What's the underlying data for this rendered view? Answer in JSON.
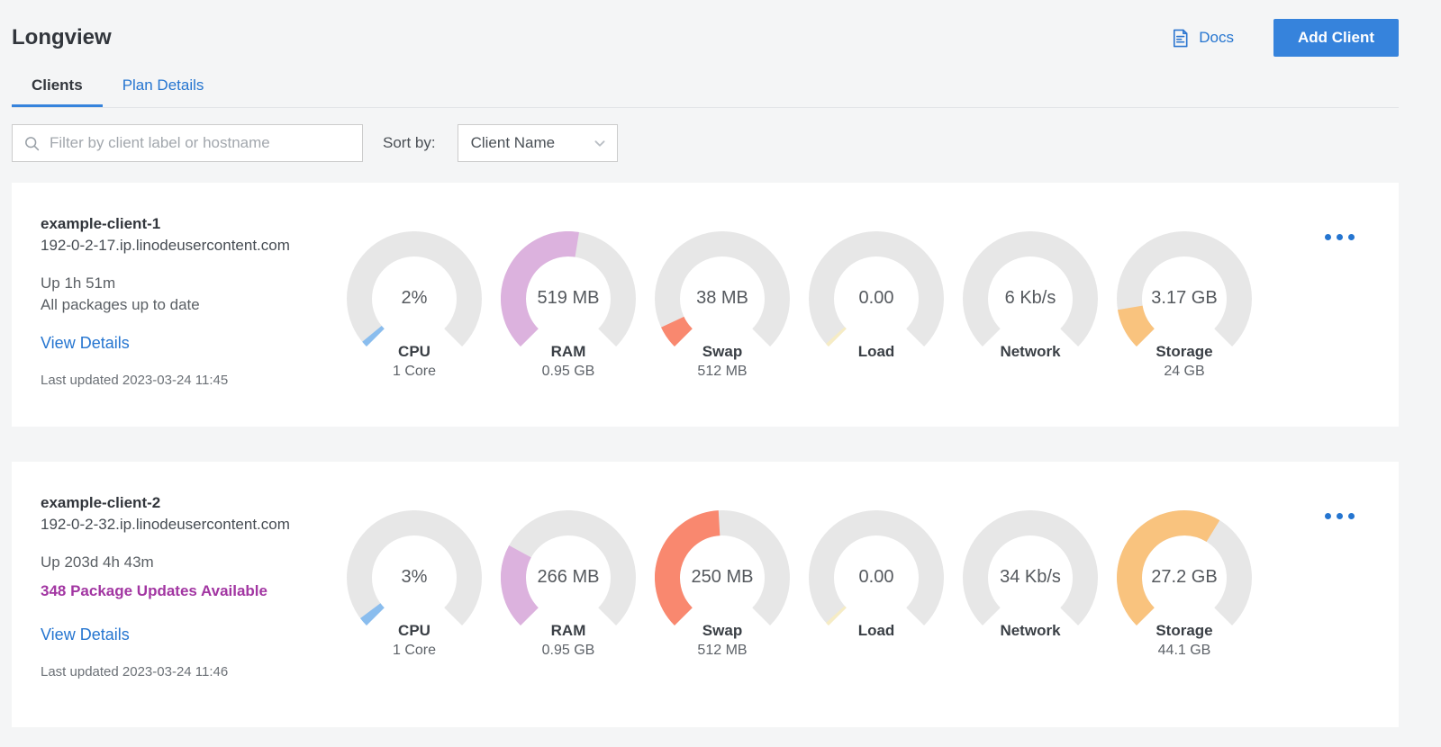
{
  "page": {
    "title": "Longview"
  },
  "header": {
    "docs_label": "Docs",
    "add_client_label": "Add Client"
  },
  "icons": {
    "docs": "document-icon",
    "search": "magnifier-icon",
    "sort": "chevron-down-icon",
    "card_menu": "ellipsis-icon"
  },
  "tabs": [
    {
      "label": "Clients",
      "active": true
    },
    {
      "label": "Plan Details",
      "active": false
    }
  ],
  "filter": {
    "placeholder": "Filter by client label or hostname",
    "sort_by_label": "Sort by:",
    "sort_value": "Client Name"
  },
  "colors": {
    "accent_blue": "#3683dc",
    "link_blue": "#2575d0",
    "package_alert_purple": "#a236a2",
    "gauge_track": "#e7e7e7",
    "cpu_blue": "#8abdee",
    "ram_purple": "#dcb2de",
    "swap_coral": "#f9886f",
    "load_yellow": "#f6ecc4",
    "storage_amber": "#f9c37e",
    "page_background": "#f4f5f6",
    "card_background": "#ffffff"
  },
  "clients": [
    {
      "name": "example-client-1",
      "hostname": "192-0-2-17.ip.linodeusercontent.com",
      "uptime": "Up 1h 51m",
      "packages": "All packages up to date",
      "view_details_label": "View Details",
      "last_updated": "Last updated 2023-03-24 11:45",
      "gauges": [
        {
          "metric": "CPU",
          "value": "2%",
          "sub": "1 Core",
          "fraction": 0.02,
          "color": "#8abdee"
        },
        {
          "metric": "RAM",
          "value": "519 MB",
          "sub": "0.95 GB",
          "fraction": 0.534,
          "color": "#dcb2de"
        },
        {
          "metric": "Swap",
          "value": "38 MB",
          "sub": "512 MB",
          "fraction": 0.074,
          "color": "#f9886f"
        },
        {
          "metric": "Load",
          "value": "0.00",
          "sub": "",
          "fraction": 0.012,
          "color": "#f6ecc4"
        },
        {
          "metric": "Network",
          "value": "6 Kb/s",
          "sub": "",
          "fraction": 0,
          "color": ""
        },
        {
          "metric": "Storage",
          "value": "3.17 GB",
          "sub": "24 GB",
          "fraction": 0.132,
          "color": "#f9c37e"
        }
      ]
    },
    {
      "name": "example-client-2",
      "hostname": "192-0-2-32.ip.linodeusercontent.com",
      "uptime": "Up 203d 4h 43m",
      "packages": "348 Package Updates Available",
      "view_details_label": "View Details",
      "last_updated": "Last updated 2023-03-24 11:46",
      "gauges": [
        {
          "metric": "CPU",
          "value": "3%",
          "sub": "1 Core",
          "fraction": 0.03,
          "color": "#8abdee"
        },
        {
          "metric": "RAM",
          "value": "266 MB",
          "sub": "0.95 GB",
          "fraction": 0.273,
          "color": "#dcb2de"
        },
        {
          "metric": "Swap",
          "value": "250 MB",
          "sub": "512 MB",
          "fraction": 0.488,
          "color": "#f9886f"
        },
        {
          "metric": "Load",
          "value": "0.00",
          "sub": "",
          "fraction": 0.012,
          "color": "#f6ecc4"
        },
        {
          "metric": "Network",
          "value": "34 Kb/s",
          "sub": "",
          "fraction": 0,
          "color": ""
        },
        {
          "metric": "Storage",
          "value": "27.2 GB",
          "sub": "44.1 GB",
          "fraction": 0.617,
          "color": "#f9c37e"
        }
      ]
    }
  ]
}
